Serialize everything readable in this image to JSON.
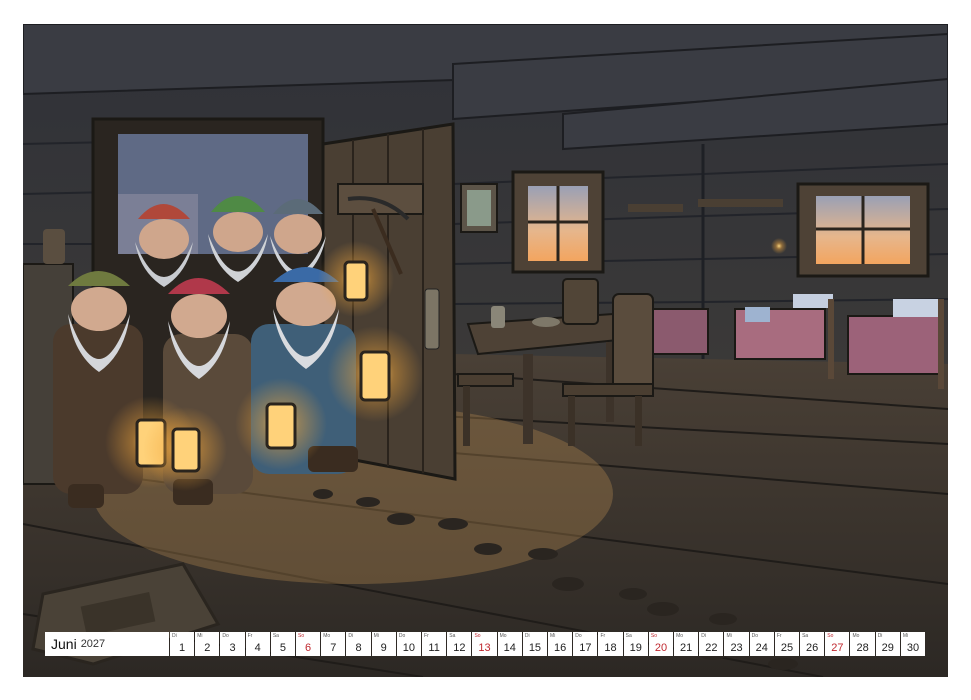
{
  "calendar": {
    "month": "Juni",
    "year": "2027",
    "days": [
      {
        "dow": "Di",
        "num": "1"
      },
      {
        "dow": "Mi",
        "num": "2"
      },
      {
        "dow": "Do",
        "num": "3"
      },
      {
        "dow": "Fr",
        "num": "4"
      },
      {
        "dow": "Sa",
        "num": "5"
      },
      {
        "dow": "So",
        "num": "6",
        "sunday": true
      },
      {
        "dow": "Mo",
        "num": "7"
      },
      {
        "dow": "Di",
        "num": "8"
      },
      {
        "dow": "Mi",
        "num": "9"
      },
      {
        "dow": "Do",
        "num": "10"
      },
      {
        "dow": "Fr",
        "num": "11"
      },
      {
        "dow": "Sa",
        "num": "12"
      },
      {
        "dow": "So",
        "num": "13",
        "sunday": true
      },
      {
        "dow": "Mo",
        "num": "14"
      },
      {
        "dow": "Di",
        "num": "15"
      },
      {
        "dow": "Mi",
        "num": "16"
      },
      {
        "dow": "Do",
        "num": "17"
      },
      {
        "dow": "Fr",
        "num": "18"
      },
      {
        "dow": "Sa",
        "num": "19"
      },
      {
        "dow": "So",
        "num": "20",
        "sunday": true
      },
      {
        "dow": "Mo",
        "num": "21"
      },
      {
        "dow": "Di",
        "num": "22"
      },
      {
        "dow": "Mi",
        "num": "23"
      },
      {
        "dow": "Do",
        "num": "24"
      },
      {
        "dow": "Fr",
        "num": "25"
      },
      {
        "dow": "Sa",
        "num": "26"
      },
      {
        "dow": "So",
        "num": "27",
        "sunday": true
      },
      {
        "dow": "Mo",
        "num": "28"
      },
      {
        "dow": "Di",
        "num": "29"
      },
      {
        "dow": "Mi",
        "num": "30"
      }
    ]
  },
  "colors": {
    "sunday": "#c0282f",
    "binding": "#2a2a2a",
    "lantern_glow": "#ffc766",
    "wood_dark": "#2f2a25",
    "wood_light": "#6a5a48"
  }
}
